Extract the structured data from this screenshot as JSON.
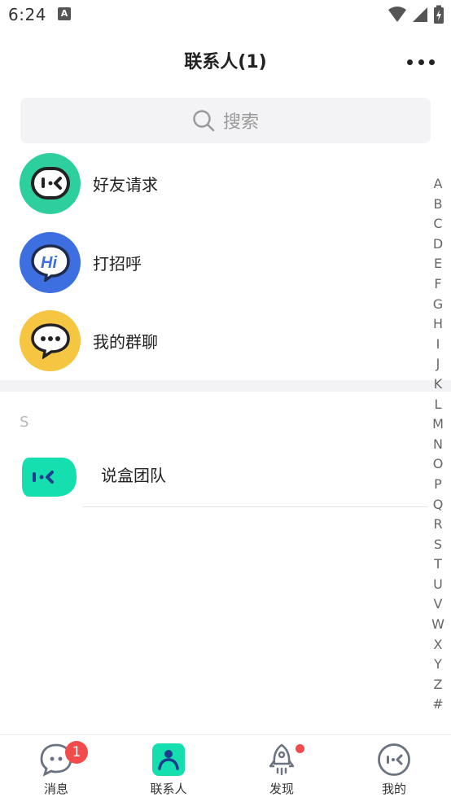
{
  "status_bar": {
    "time": "6:24",
    "notification_glyph": "A"
  },
  "header": {
    "title": "联系人(1)"
  },
  "search": {
    "placeholder": "搜索"
  },
  "functions": [
    {
      "label": "好友请求",
      "icon": "friend-request-icon",
      "color": "#2ecf9f"
    },
    {
      "label": "打招呼",
      "icon": "hi-bubble-icon",
      "color": "#3e6fe0",
      "icon_text": "Hi"
    },
    {
      "label": "我的群聊",
      "icon": "group-chat-icon",
      "color": "#f6c542"
    }
  ],
  "section": {
    "letter": "S"
  },
  "contacts": [
    {
      "name": "说盒团队",
      "avatar": "shuohe-logo-icon",
      "color": "#12e5b0"
    }
  ],
  "index_letters": [
    "A",
    "B",
    "C",
    "D",
    "E",
    "F",
    "G",
    "H",
    "I",
    "J",
    "K",
    "L",
    "M",
    "N",
    "O",
    "P",
    "Q",
    "R",
    "S",
    "T",
    "U",
    "V",
    "W",
    "X",
    "Y",
    "Z",
    "#"
  ],
  "tabs": [
    {
      "label": "消息",
      "icon": "message-icon",
      "badge": "1",
      "active": false
    },
    {
      "label": "联系人",
      "icon": "contacts-icon",
      "active": true
    },
    {
      "label": "发现",
      "icon": "discover-rocket-icon",
      "dot": true,
      "active": false
    },
    {
      "label": "我的",
      "icon": "profile-icon",
      "active": false
    }
  ],
  "colors": {
    "accent": "#15dfae",
    "badge": "#f24b4b"
  }
}
